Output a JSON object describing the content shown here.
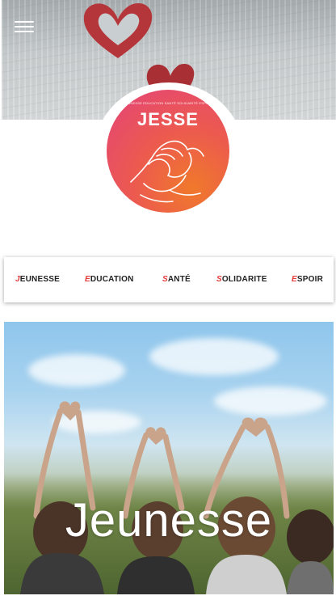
{
  "header": {
    "menu_icon": "hamburger-menu-icon"
  },
  "logo": {
    "small_text": "JEUNESSE EDUCATION SANTÉ SOLIDARITÉ ESPOIR",
    "title": "JESSE",
    "emblem_icon": "clasped-hands-icon",
    "colors": {
      "from": "#e3437a",
      "to": "#f0792b"
    }
  },
  "nav": {
    "accent_color": "#e33b3b",
    "items": [
      {
        "initial": "J",
        "rest": "EUNESSE"
      },
      {
        "initial": "E",
        "rest": "DUCATION"
      },
      {
        "initial": "S",
        "rest": "ANTÉ"
      },
      {
        "initial": "S",
        "rest": "OLIDARITE"
      },
      {
        "initial": "E",
        "rest": "SPOIR"
      }
    ]
  },
  "feature": {
    "title": "Jeunesse"
  }
}
